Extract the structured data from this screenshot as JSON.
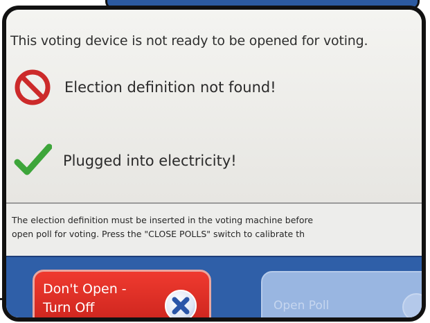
{
  "status": {
    "notice": "This voting device is not ready to be opened for voting.",
    "checks": [
      {
        "text": "Election definition not found!",
        "icon": "no-entry-icon",
        "state": "error",
        "color": "#cc2a2a"
      },
      {
        "text": "Plugged into electricity!",
        "icon": "checkmark-icon",
        "state": "ok",
        "color": "#3da53a"
      }
    ]
  },
  "instructions": {
    "line1": "The election definition must be inserted in the voting machine before",
    "line2": "open poll for voting.  Press the \"CLOSE POLLS\" switch to calibrate th"
  },
  "actions": {
    "dont_open_line1": "Don't Open -",
    "dont_open_line2": "Turn Off",
    "open_poll_label": "Open Poll",
    "dont_open_color": "#d52a22",
    "bar_color": "#2f5fa8",
    "open_poll_disabled": true
  }
}
